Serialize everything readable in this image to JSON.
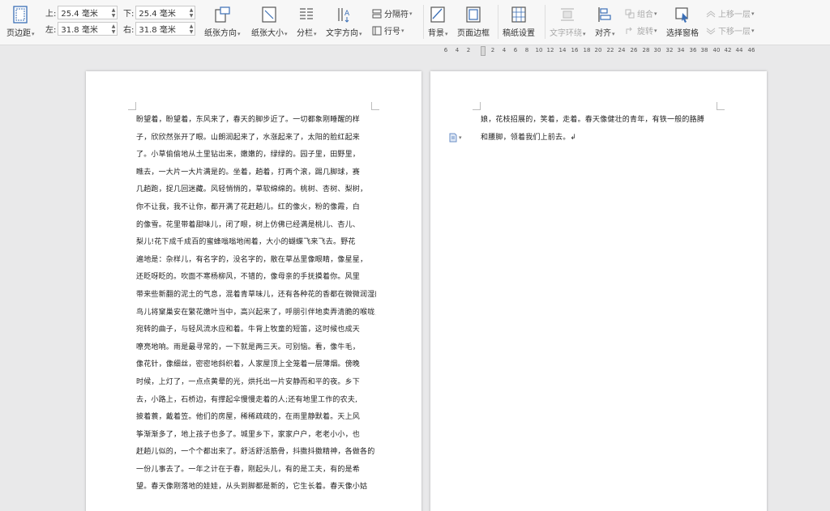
{
  "toolbar": {
    "margin_button": "页边距",
    "margins": {
      "top_label": "上:",
      "top_value": "25.4 毫米",
      "bottom_label": "下:",
      "bottom_value": "25.4 毫米",
      "left_label": "左:",
      "left_value": "31.8 毫米",
      "right_label": "右:",
      "right_value": "31.8 毫米"
    },
    "paper_direction": "纸张方向",
    "paper_size": "纸张大小",
    "columns": "分栏",
    "text_direction": "文字方向",
    "separator": "分隔符",
    "line_number": "行号",
    "background": "背景",
    "page_border": "页面边框",
    "draft_paper": "稿纸设置",
    "text_wrap": "文字环绕",
    "align": "对齐",
    "group": "组合",
    "rotate": "旋转",
    "select_pane": "选择窗格",
    "bring_forward": "上移一层",
    "send_backward": "下移一层",
    "colors": {
      "accent": "#3b6fb6",
      "disabled": "#a9a9a9"
    }
  },
  "ruler": {
    "ticks": [
      "6",
      "4",
      "2",
      "2",
      "4",
      "6",
      "8",
      "10",
      "12",
      "14",
      "16",
      "18",
      "20",
      "22",
      "24",
      "26",
      "28",
      "30",
      "32",
      "34",
      "36",
      "38",
      "40",
      "42",
      "44",
      "46"
    ]
  },
  "page1": {
    "lines": [
      "盼望着，盼望着，东风来了，春天的脚步近了。一切都象刚睡醒的样",
      "子，欣欣然张开了眼。山朗润起来了，水涨起来了，太阳的脸红起来",
      "了。小草偷偷地从土里钻出来，嫩嫩的，绿绿的。园子里，田野里，",
      "瞧去，一大片一大片满是的。坐着，趟着，打两个滚，踢几脚球，赛",
      "几趟跑，捉几回迷藏。风轻悄悄的，草软绵绵的。桃树、杏树、梨树，",
      "你不让我，我不让你，都开满了花赶趟儿。红的像火，粉的像霞，白",
      "的像雪。花里带着甜味儿，闭了眼，树上仿佛已经满是桃儿、杏儿、",
      "梨儿!花下成千成百的蜜蜂嗡嗡地闹着，大小的蝴蝶飞来飞去。野花",
      "遍地是：杂样儿，有名字的，没名字的，散在草丛里像眼睛，像星星，",
      "还眨呀眨的。吹面不寒杨柳风，不错的，像母亲的手抚摸着你。风里",
      "带来些新翻的泥土的气息，混着青草味儿，还有各种花的香都在微微润湿的空气里酝酿。",
      "鸟儿将窠巢安在繁花嫩叶当中，高兴起来了，呼朋引伴地卖弄清脆的喉咙，唱出",
      "宛转的曲子，与轻风流水应和着。牛背上牧童的短笛，这时候也成天",
      "嘹亮地响。雨是最寻常的，一下就是两三天。可别恼。看，像牛毛，",
      "像花针，像细丝，密密地斜织着，人家屋顶上全笼着一层薄烟。傍晚",
      "时候，上灯了，一点点黄晕的光，烘托出一片安静而和平的夜。乡下",
      "去，小路上，石桥边，有撑起伞慢慢走着的人;还有地里工作的农夫,",
      "披着蓑，戴着笠。他们的房屋，稀稀疏疏的，在雨里静默着。天上风",
      "筝渐渐多了，地上孩子也多了。城里乡下，家家户户，老老小小，也",
      "赶趟儿似的，一个个都出来了。舒活舒活筋骨，抖擞抖擞精神，各做各的",
      "一份儿事去了。一年之计在于春，刚起头儿，有的是工夫，有的是希",
      "望。春天像刚落地的娃娃，从头到脚都是新的，它生长着。春天像小姑"
    ]
  },
  "page2": {
    "lines": [
      "娘，花枝招展的，笑着，走着。春天像健壮的青年，有铁一般的胳膊",
      "和腰脚，领着我们上前去。↲"
    ]
  }
}
